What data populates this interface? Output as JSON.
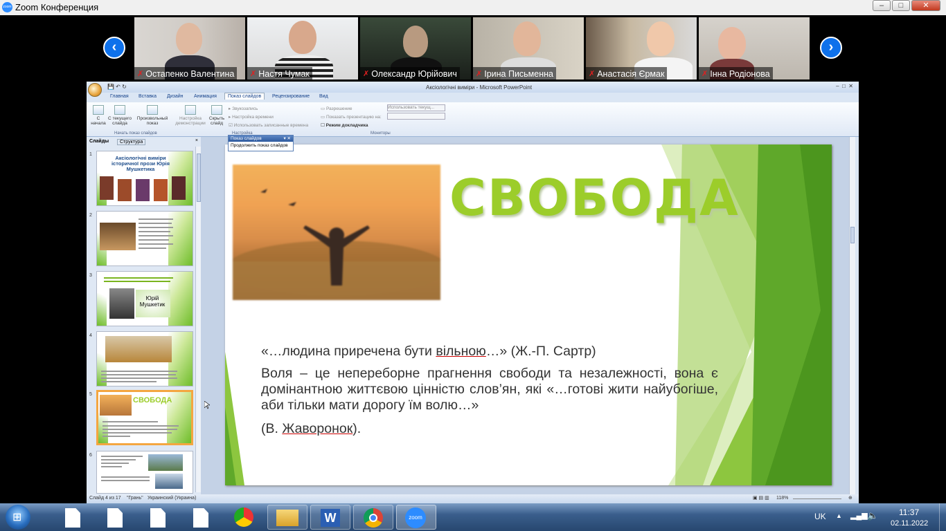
{
  "zoom": {
    "title": "Zoom Конференция",
    "logo_text": "zoom",
    "participants": [
      {
        "name": "Остапенко Валентина"
      },
      {
        "name": "Настя Чумак"
      },
      {
        "name": "Олександр Юрійович"
      },
      {
        "name": "Ірина Письменна"
      },
      {
        "name": "Анастасія Єрмак"
      },
      {
        "name": "Інна Родіонова"
      }
    ],
    "prev_icon": "chevron-left-icon",
    "next_icon": "chevron-right-icon"
  },
  "ppt": {
    "window_title": "Аксіологічні виміри - Microsoft PowerPoint",
    "tabs": [
      "Главная",
      "Вставка",
      "Дизайн",
      "Анимация",
      "Показ слайдов",
      "Рецензирование",
      "Вид"
    ],
    "active_tab": "Показ слайдов",
    "ribbon": {
      "btn_start": "С начала",
      "btn_current": "С текущего слайда",
      "btn_custom": "Произвольный показ",
      "group_start": "Начать показ слайдов",
      "btn_setup": "Настройка демонстрации",
      "btn_hide": "Скрыть слайд",
      "rehearse": "Звукозапись",
      "timings": "Настройка времени",
      "use_timings": "Использовать записанные времена",
      "group_setup": "Настройка",
      "resolution": "Разрешение",
      "resolution_value": "Использовать текущ...",
      "show_on": "Показать презентацию на:",
      "presenter_view": "Режим докладчика",
      "group_monitors": "Мониторы"
    },
    "popup": {
      "title": "Показ слайдов",
      "item": "Продолжить показ слайдов"
    },
    "pane_tabs": {
      "slides": "Слайды",
      "outline": "Структура"
    },
    "thumbs": [
      {
        "num": "1",
        "title": "Аксіологічні виміри історичної прози Юрія Мушкетика"
      },
      {
        "num": "2",
        "title": ""
      },
      {
        "num": "3",
        "title": "Юрій Мушкетик"
      },
      {
        "num": "4",
        "title": ""
      },
      {
        "num": "5",
        "title": "СВОБОДА"
      },
      {
        "num": "6",
        "title": ""
      }
    ],
    "slide": {
      "title": "СВОБОДА",
      "quote1_pre": "«…людина приречена бути ",
      "quote1_word": "вільною",
      "quote1_post": "…» (Ж.-П. Сартр)",
      "para": "Воля – це непереборне прагнення свободи та незалежності, вона є домінантною життєвою цінністю слов’ян, які «…готові жити найубогіше, аби тільки мати дорогу їм волю…»",
      "cite_pre": "(В. ",
      "cite_word": "Жаворонок",
      "cite_post": ")."
    },
    "status": {
      "slide_of": "Слайд 4 из 17",
      "theme": "\"Грань\"",
      "lang": "Украинский (Украина)",
      "zoom": "118%"
    }
  },
  "taskbar": {
    "lang": "UK",
    "time": "11:37",
    "date": "02.11.2022",
    "zoom_label": "zoom"
  }
}
